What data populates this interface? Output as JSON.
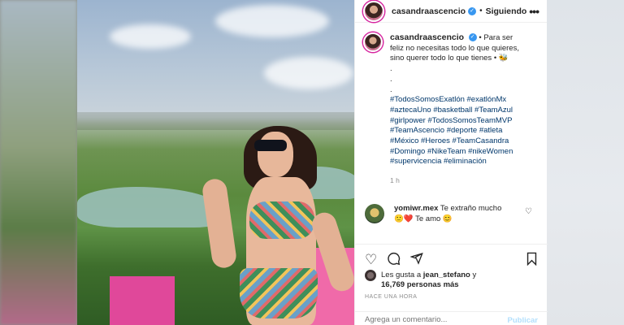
{
  "post": {
    "username": "casandraascencio",
    "verified_icon": "verified-badge-icon",
    "follow_status": "Siguiendo",
    "caption": "Para ser feliz no necesitas todo lo que quieres, sino querer todo lo que tienes",
    "caption_bullet_start": "•",
    "caption_bullet_end": "•",
    "caption_emoji": "🐝",
    "caption_fillers": [
      ".",
      ".",
      "."
    ],
    "hashtags": "#TodosSomosExatlón #exatlónMx #aztecaUno #basketball #TeamAzul #girlpower #TodosSomosTeamMVP #TeamAscencio #deporte #atleta #México #Heroes #TeamCasandra #Domingo #NikeTeam #nikeWomen #supervicencia #eliminación",
    "time_ago": "1 h"
  },
  "comment": {
    "username": "yomiwr.mex",
    "text": "Te extraño mucho",
    "line2": "🙂❤️ Te amo 😊"
  },
  "likes": {
    "prefix": "Les gusta a",
    "user": "jean_stefano",
    "connector": "y",
    "count": "16,769 personas más"
  },
  "timestamp": "HACE UNA HORA",
  "add_comment": {
    "placeholder": "Agrega un comentario...",
    "publish": "Publicar"
  },
  "icons": {
    "more": "more-options-icon",
    "like": "heart-icon",
    "comment": "comment-icon",
    "share": "share-icon",
    "save": "bookmark-icon"
  },
  "colors": {
    "hashtag": "#00376b",
    "verified": "#3897f0",
    "publish_disabled": "#b2dffc"
  }
}
